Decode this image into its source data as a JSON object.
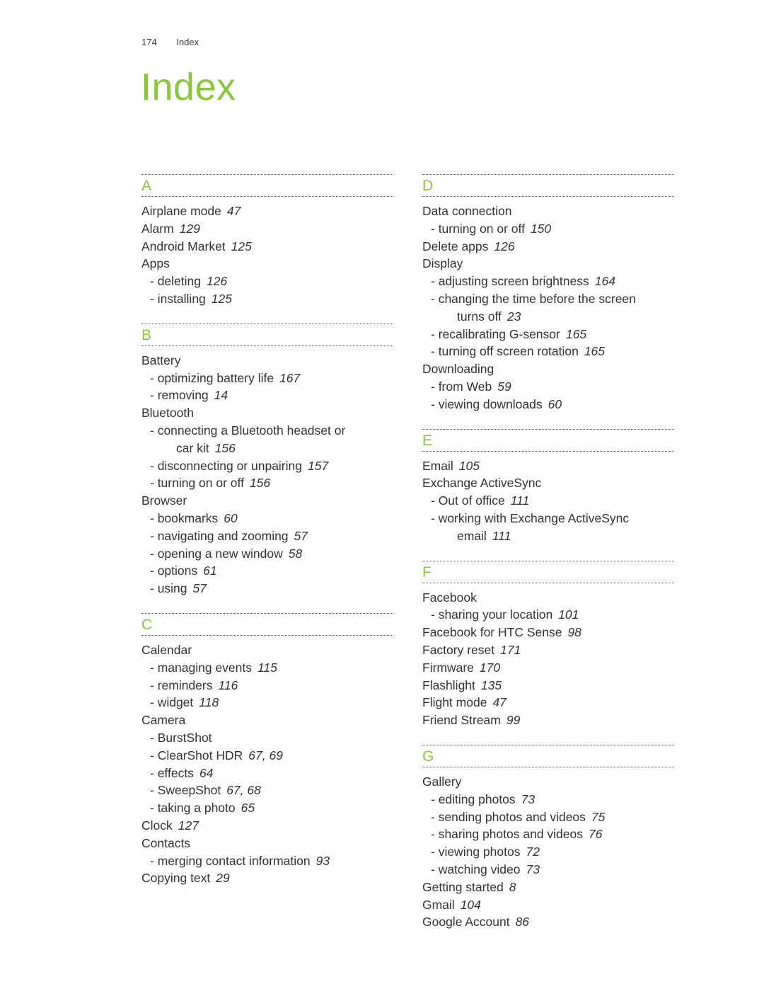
{
  "header": {
    "page_number": "174",
    "section": "Index"
  },
  "title": "Index",
  "accent_color": "#8cc63f",
  "columns": [
    {
      "sections": [
        {
          "letter": "A",
          "entries": [
            {
              "text": "Airplane mode",
              "pages": "47",
              "level": "main"
            },
            {
              "text": "Alarm",
              "pages": "129",
              "level": "main"
            },
            {
              "text": "Android Market",
              "pages": "125",
              "level": "main"
            },
            {
              "text": "Apps",
              "pages": "",
              "level": "main"
            },
            {
              "text": "- deleting",
              "pages": "126",
              "level": "sub"
            },
            {
              "text": "- installing",
              "pages": "125",
              "level": "sub"
            }
          ]
        },
        {
          "letter": "B",
          "entries": [
            {
              "text": "Battery",
              "pages": "",
              "level": "main"
            },
            {
              "text": "- optimizing battery life",
              "pages": "167",
              "level": "sub"
            },
            {
              "text": "- removing",
              "pages": "14",
              "level": "sub"
            },
            {
              "text": "Bluetooth",
              "pages": "",
              "level": "main"
            },
            {
              "text": "- connecting a Bluetooth headset or",
              "pages": "",
              "level": "sub"
            },
            {
              "text": "car kit",
              "pages": "156",
              "level": "cont"
            },
            {
              "text": "- disconnecting or unpairing",
              "pages": "157",
              "level": "sub"
            },
            {
              "text": "- turning on or off",
              "pages": "156",
              "level": "sub"
            },
            {
              "text": "Browser",
              "pages": "",
              "level": "main"
            },
            {
              "text": "- bookmarks",
              "pages": "60",
              "level": "sub"
            },
            {
              "text": "- navigating and zooming",
              "pages": "57",
              "level": "sub"
            },
            {
              "text": "- opening a new window",
              "pages": "58",
              "level": "sub"
            },
            {
              "text": "- options",
              "pages": "61",
              "level": "sub"
            },
            {
              "text": "- using",
              "pages": "57",
              "level": "sub"
            }
          ]
        },
        {
          "letter": "C",
          "entries": [
            {
              "text": "Calendar",
              "pages": "",
              "level": "main"
            },
            {
              "text": "- managing events",
              "pages": "115",
              "level": "sub"
            },
            {
              "text": "- reminders",
              "pages": "116",
              "level": "sub"
            },
            {
              "text": "- widget",
              "pages": "118",
              "level": "sub"
            },
            {
              "text": "Camera",
              "pages": "",
              "level": "main"
            },
            {
              "text": "- BurstShot",
              "pages": "",
              "level": "sub"
            },
            {
              "text": "- ClearShot HDR",
              "pages": "67, 69",
              "level": "sub"
            },
            {
              "text": "- effects",
              "pages": "64",
              "level": "sub"
            },
            {
              "text": "- SweepShot",
              "pages": "67, 68",
              "level": "sub"
            },
            {
              "text": "- taking a photo",
              "pages": "65",
              "level": "sub"
            },
            {
              "text": "Clock",
              "pages": "127",
              "level": "main"
            },
            {
              "text": "Contacts",
              "pages": "",
              "level": "main"
            },
            {
              "text": "- merging contact information",
              "pages": "93",
              "level": "sub"
            },
            {
              "text": "Copying text",
              "pages": "29",
              "level": "main"
            }
          ]
        }
      ]
    },
    {
      "sections": [
        {
          "letter": "D",
          "entries": [
            {
              "text": "Data connection",
              "pages": "",
              "level": "main"
            },
            {
              "text": "- turning on or off",
              "pages": "150",
              "level": "sub"
            },
            {
              "text": "Delete apps",
              "pages": "126",
              "level": "main"
            },
            {
              "text": "Display",
              "pages": "",
              "level": "main"
            },
            {
              "text": "- adjusting screen brightness",
              "pages": "164",
              "level": "sub"
            },
            {
              "text": "- changing the time before the screen",
              "pages": "",
              "level": "sub"
            },
            {
              "text": "turns off",
              "pages": "23",
              "level": "cont"
            },
            {
              "text": "- recalibrating G-sensor",
              "pages": "165",
              "level": "sub"
            },
            {
              "text": "- turning off screen rotation",
              "pages": "165",
              "level": "sub"
            },
            {
              "text": "Downloading",
              "pages": "",
              "level": "main"
            },
            {
              "text": "- from Web",
              "pages": "59",
              "level": "sub"
            },
            {
              "text": "- viewing downloads",
              "pages": "60",
              "level": "sub"
            }
          ]
        },
        {
          "letter": "E",
          "entries": [
            {
              "text": "Email",
              "pages": "105",
              "level": "main"
            },
            {
              "text": "Exchange ActiveSync",
              "pages": "",
              "level": "main"
            },
            {
              "text": "- Out of office",
              "pages": "111",
              "level": "sub"
            },
            {
              "text": "- working with Exchange ActiveSync",
              "pages": "",
              "level": "sub"
            },
            {
              "text": "email",
              "pages": "111",
              "level": "cont"
            }
          ]
        },
        {
          "letter": "F",
          "entries": [
            {
              "text": "Facebook",
              "pages": "",
              "level": "main"
            },
            {
              "text": "- sharing your location",
              "pages": "101",
              "level": "sub"
            },
            {
              "text": "Facebook for HTC Sense",
              "pages": "98",
              "level": "main"
            },
            {
              "text": "Factory reset",
              "pages": "171",
              "level": "main"
            },
            {
              "text": "Firmware",
              "pages": "170",
              "level": "main"
            },
            {
              "text": "Flashlight",
              "pages": "135",
              "level": "main"
            },
            {
              "text": "Flight mode",
              "pages": "47",
              "level": "main"
            },
            {
              "text": "Friend Stream",
              "pages": "99",
              "level": "main"
            }
          ]
        },
        {
          "letter": "G",
          "entries": [
            {
              "text": "Gallery",
              "pages": "",
              "level": "main"
            },
            {
              "text": "- editing photos",
              "pages": "73",
              "level": "sub"
            },
            {
              "text": "- sending photos and videos",
              "pages": "75",
              "level": "sub"
            },
            {
              "text": "- sharing photos and videos",
              "pages": "76",
              "level": "sub"
            },
            {
              "text": "- viewing photos",
              "pages": "72",
              "level": "sub"
            },
            {
              "text": "- watching video",
              "pages": "73",
              "level": "sub"
            },
            {
              "text": "Getting started",
              "pages": "8",
              "level": "main"
            },
            {
              "text": "Gmail",
              "pages": "104",
              "level": "main"
            },
            {
              "text": "Google Account",
              "pages": "86",
              "level": "main"
            }
          ]
        }
      ]
    }
  ]
}
